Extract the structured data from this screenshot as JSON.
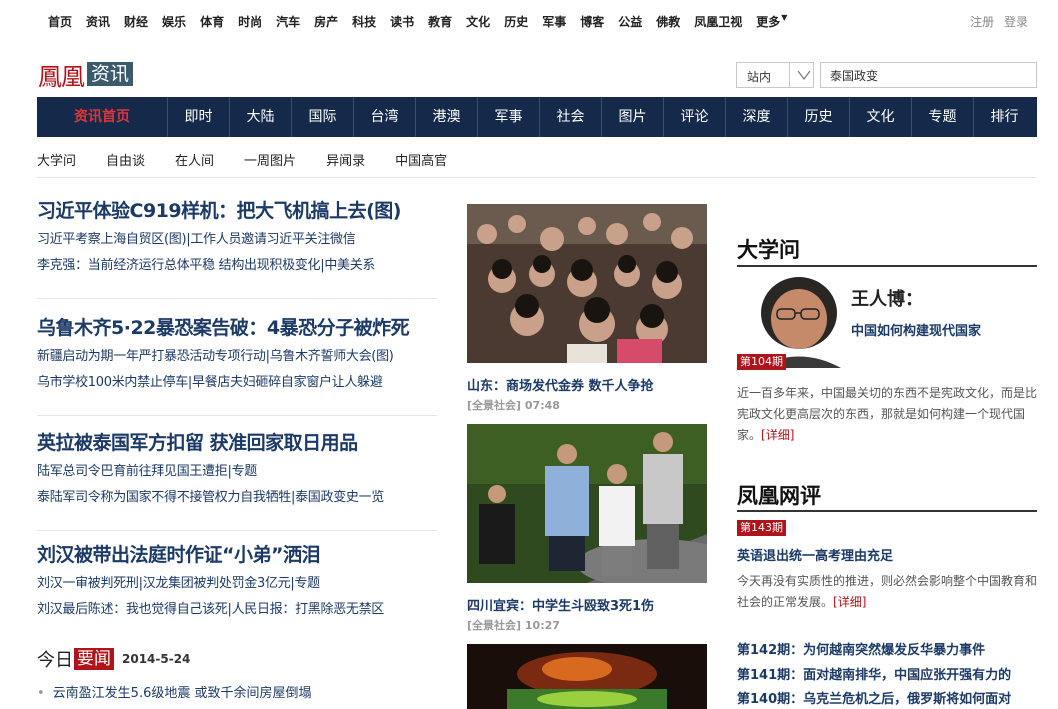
{
  "top_nav": [
    "首页",
    "资讯",
    "财经",
    "娱乐",
    "体育",
    "时尚",
    "汽车",
    "房产",
    "科技",
    "读书",
    "教育",
    "文化",
    "历史",
    "军事",
    "博客",
    "公益",
    "佛教",
    "凤凰卫视",
    "更多"
  ],
  "user_links": {
    "register": "注册",
    "login": "登录"
  },
  "logo": {
    "brand": "鳳凰",
    "section": "资讯"
  },
  "search": {
    "scope": "站内",
    "query": "泰国政变"
  },
  "channels": [
    "资讯首页",
    "即时",
    "大陆",
    "国际",
    "台湾",
    "港澳",
    "军事",
    "社会",
    "图片",
    "评论",
    "深度",
    "历史",
    "文化",
    "专题",
    "排行"
  ],
  "sub_nav": [
    "大学问",
    "自由谈",
    "在人间",
    "一周图片",
    "异闻录",
    "中国高官"
  ],
  "stories": [
    {
      "headline": "习近平体验C919样机：把大飞机搞上去(图)",
      "subs": [
        [
          "习近平考察上海自贸区(图)",
          "工作人员邀请习近平关注微信"
        ],
        [
          "李克强：当前经济运行总体平稳 结构出现积极变化",
          "中美关系"
        ]
      ]
    },
    {
      "headline": "乌鲁木齐5·22暴恐案告破：4暴恐分子被炸死",
      "subs": [
        [
          "新疆启动为期一年严打暴恐活动专项行动",
          "乌鲁木齐誓师大会(图)"
        ],
        [
          "乌市学校100米内禁止停车",
          "早餐店夫妇砸碎自家窗户让人躲避"
        ]
      ]
    },
    {
      "headline": "英拉被泰国军方扣留 获准回家取日用品",
      "subs": [
        [
          "陆军总司令巴育前往拜见国王遭拒",
          "专题"
        ],
        [
          "泰陆军司令称为国家不得不接管权力自我牺牲",
          "泰国政变史一览"
        ]
      ]
    },
    {
      "headline": "刘汉被带出法庭时作证“小弟”洒泪",
      "subs": [
        [
          "刘汉一审被判死刑",
          "汉龙集团被判处罚金3亿元",
          "专题"
        ],
        [
          "刘汉最后陈述：我也觉得自己该死",
          "人民日报：打黑除恶无禁区"
        ]
      ]
    }
  ],
  "today": {
    "label1": "今日",
    "label2": "要闻",
    "date": "2014-5-24",
    "item": "云南盈江发生5.6级地震 或致千余间房屋倒塌"
  },
  "photos": [
    {
      "caption": "山东：商场发代金券 数千人争抢",
      "meta": "[全景社会] 07:48"
    },
    {
      "caption": "四川宜宾：中学生斗殴致3死1伤",
      "meta": "[全景社会] 10:27"
    }
  ],
  "daxuewen": {
    "title": "大学问",
    "issue": "第104期",
    "name": "王人博：",
    "article": "中国如何构建现代国家",
    "summary": "近一百多年来，中国最关切的东西不是宪政文化，而是比宪政文化更高层次的东西，那就是如何构建一个现代国家。",
    "more": "[详细]"
  },
  "pinglun": {
    "title": "凤凰网评",
    "issue": "第143期",
    "headline": "英语退出统一高考理由充足",
    "summary": "今天再没有实质性的推进，则必然会影响整个中国教育和社会的正常发展。",
    "more": "[详细]",
    "past": [
      "第142期：为何越南突然爆发反华暴力事件",
      "第141期：面对越南排华，中国应张开强有力的",
      "第140期：乌克兰危机之后，俄罗斯将如何面对"
    ]
  },
  "colors": {
    "nav_bg": "#152a4a",
    "accent": "#b0141a",
    "link": "#1c3a66"
  }
}
